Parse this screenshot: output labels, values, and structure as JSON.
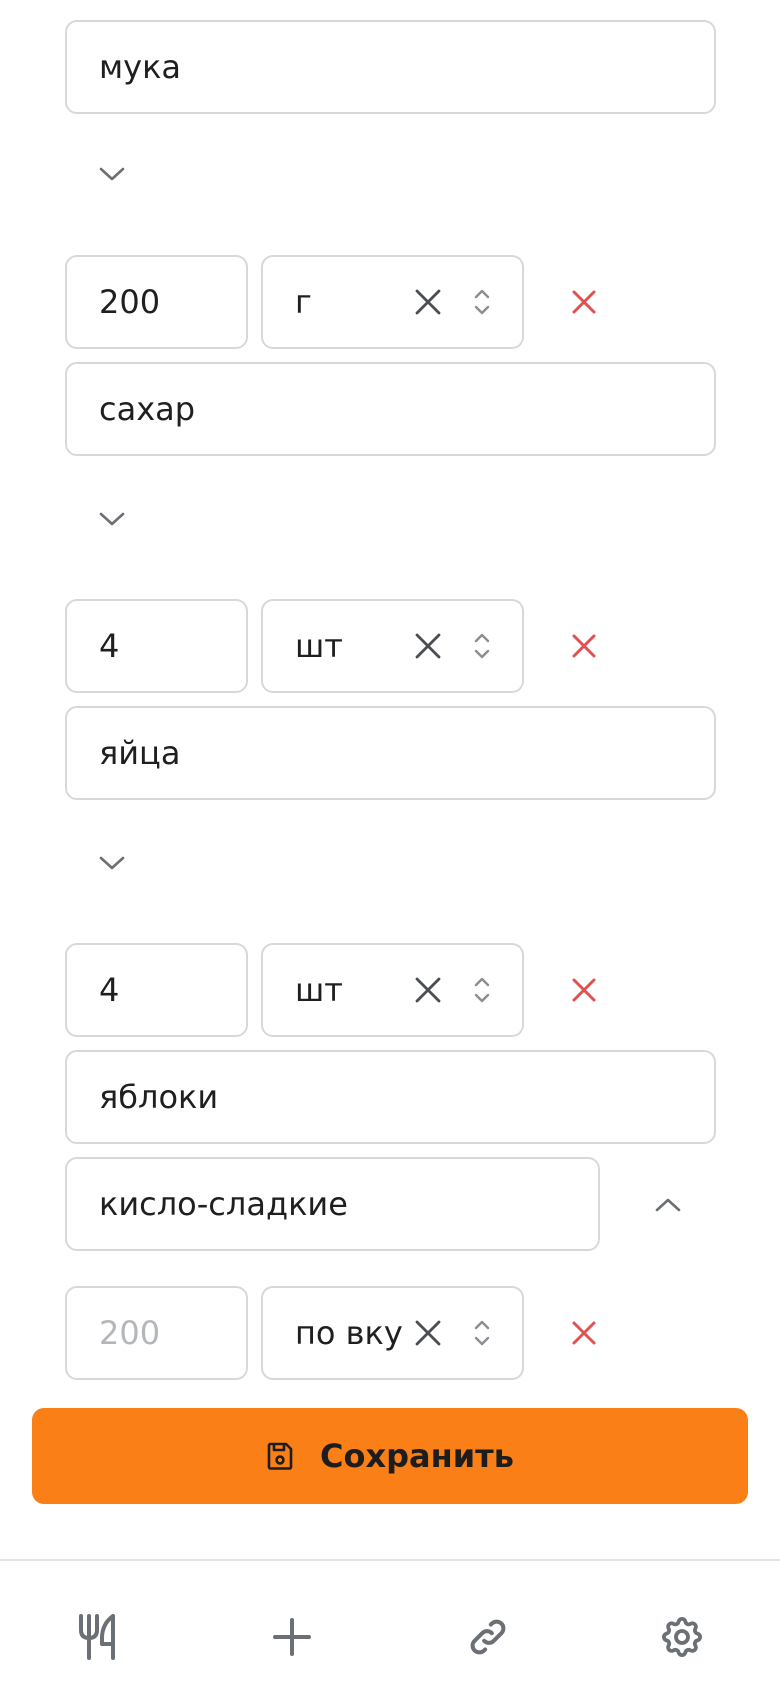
{
  "ingredients": [
    {
      "name": "мука"
    },
    {
      "amount": "200",
      "unit": "г",
      "name": "сахар"
    },
    {
      "amount": "4",
      "unit": "шт",
      "name": "яйца"
    },
    {
      "amount": "4",
      "unit": "шт",
      "name": "яблоки",
      "note": "кисло-сладкие"
    },
    {
      "amount_placeholder": "200",
      "unit": "по вкусу"
    }
  ],
  "save_label": "Сохранить",
  "icons": {
    "save": "floppy-disk-icon",
    "clear": "x-icon",
    "updown": "chevron-up-down-icon",
    "remove": "x-icon-red",
    "collapse": "chevron-down-icon",
    "expand": "chevron-up-icon",
    "nav_recipes": "fork-knife-icon",
    "nav_add": "plus-icon",
    "nav_link": "link-icon",
    "nav_settings": "gear-icon"
  },
  "colors": {
    "accent": "#f97f16",
    "remove": "#e05252",
    "border": "#d6d8dc",
    "icon": "#6b6f76"
  }
}
